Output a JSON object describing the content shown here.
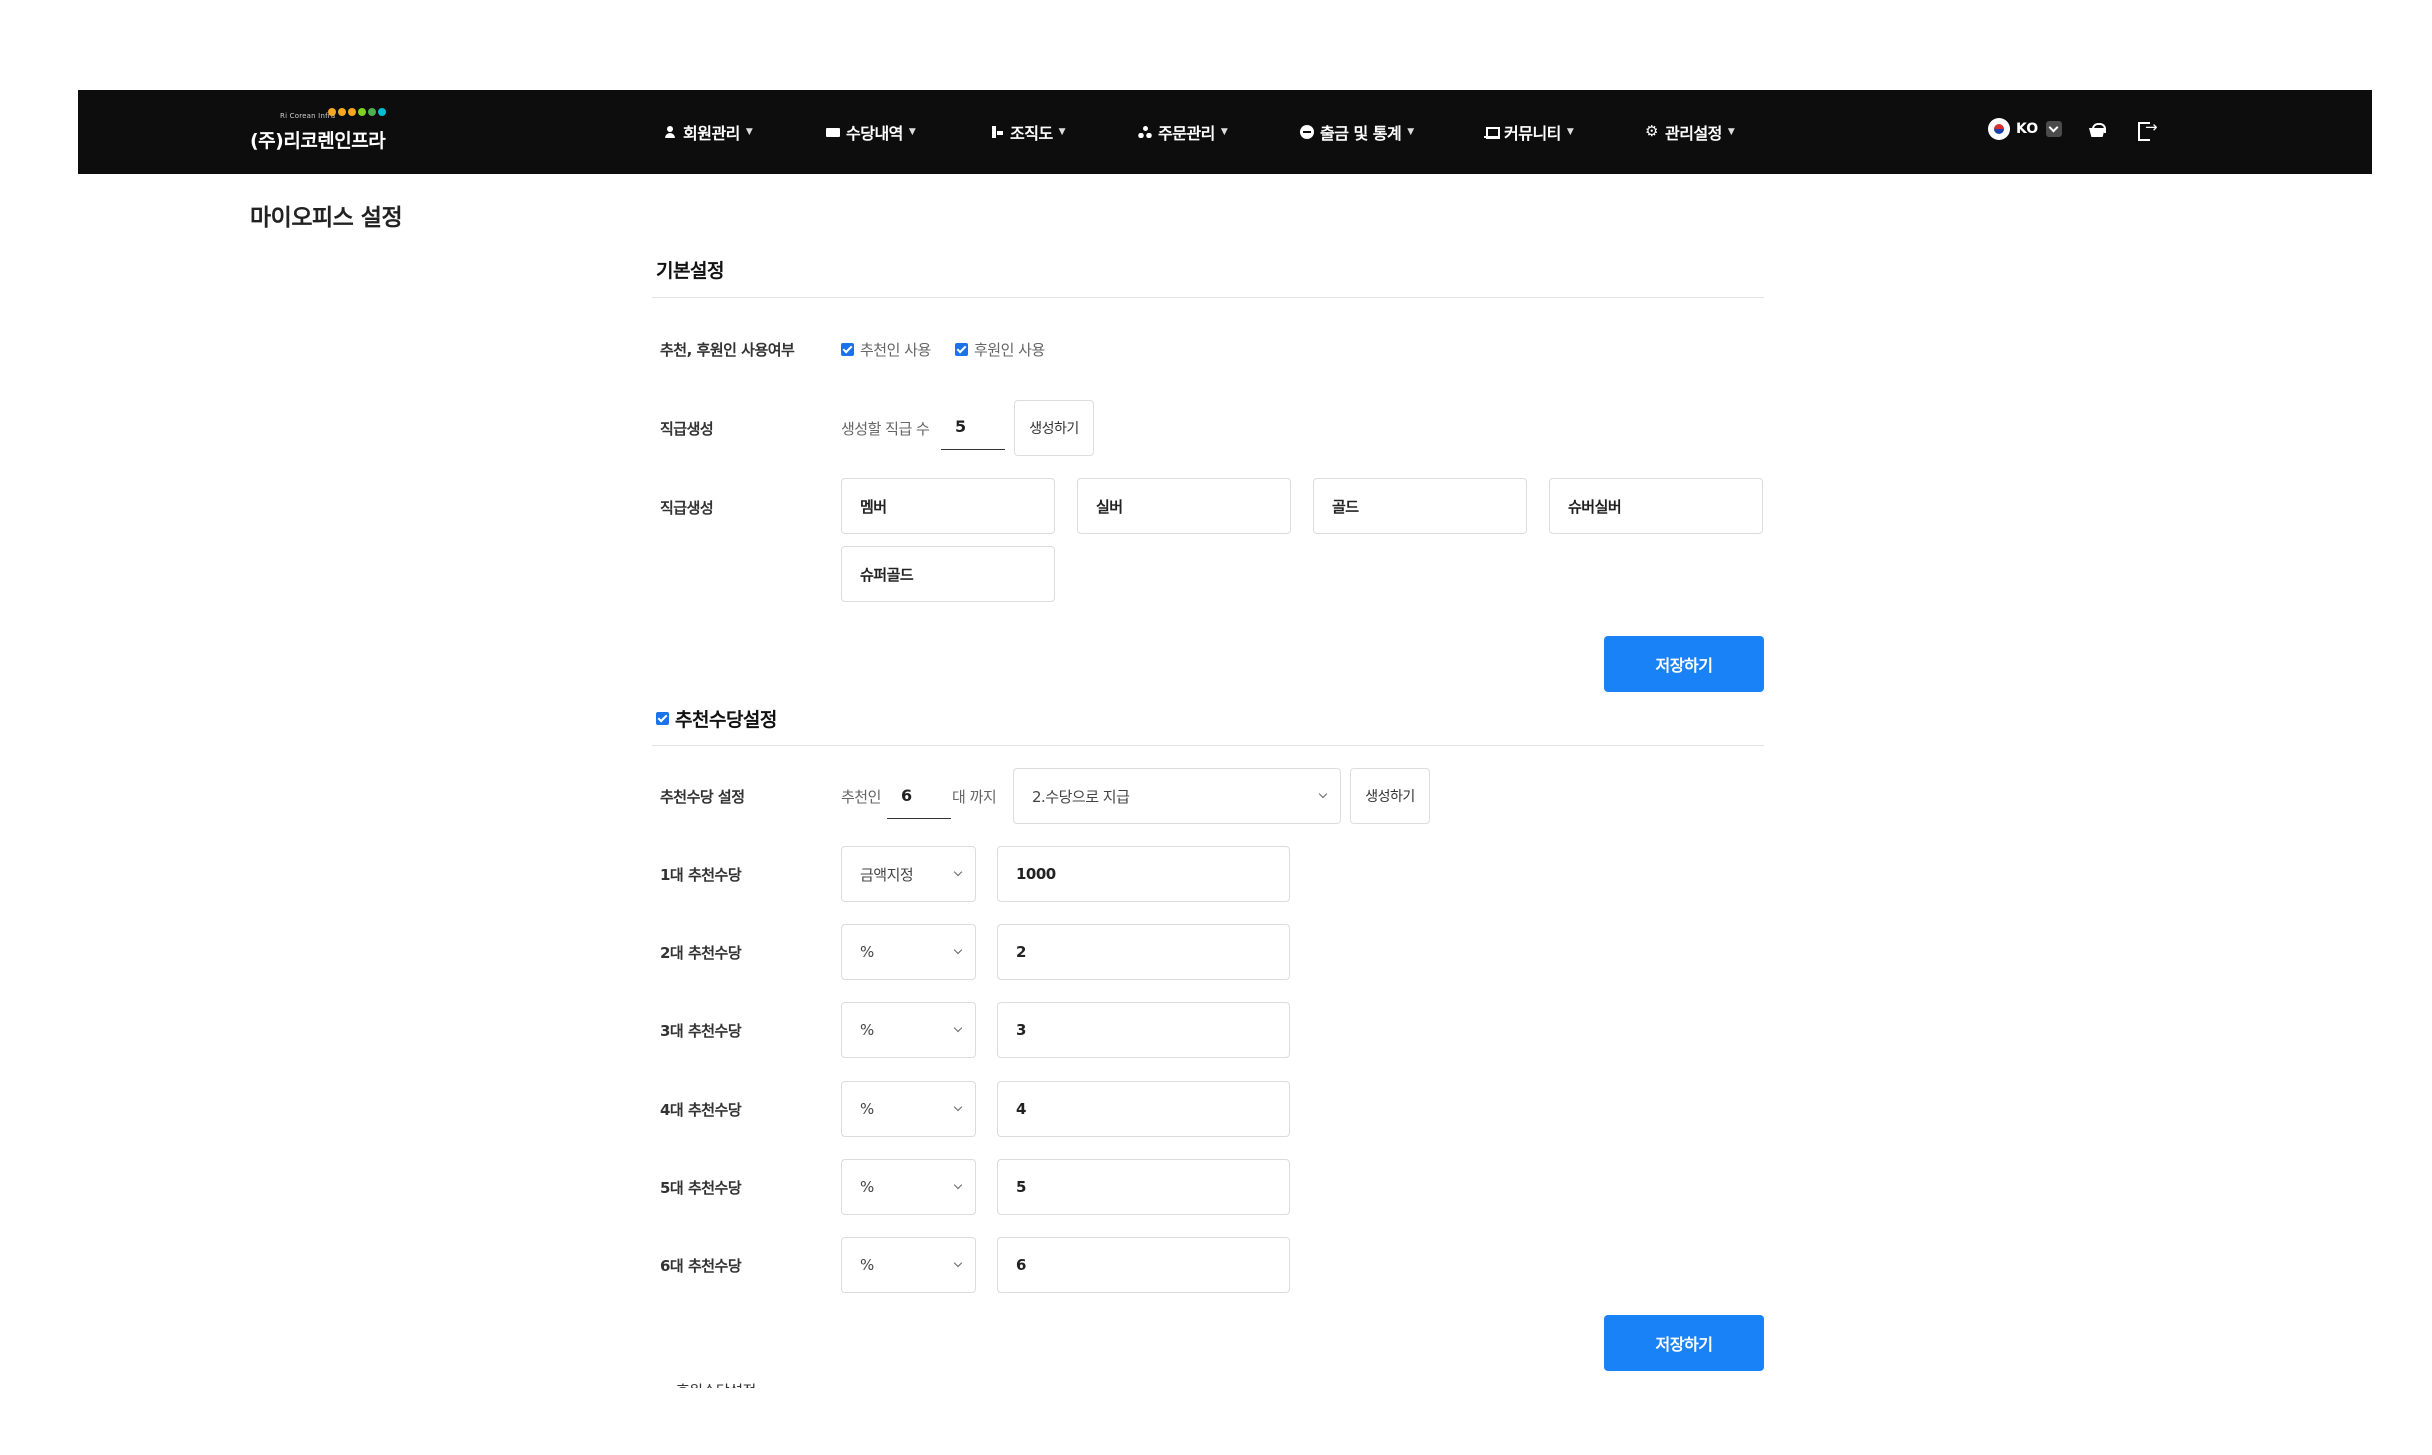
{
  "nav": {
    "logo_sub": "Ri Corean Infra",
    "logo_text": "(주)리코렌인프라",
    "logo_dot_colors": [
      "#f5a623",
      "#f5a623",
      "#f5a623",
      "#7ed321",
      "#4caf50",
      "#00bcd4"
    ],
    "menus": [
      "회원관리",
      "수당내역",
      "조직도",
      "주문관리",
      "출금 및 통계",
      "커뮤니티",
      "관리설정"
    ],
    "lang": "KO"
  },
  "page": {
    "title": "마이오피스 설정"
  },
  "basic": {
    "title": "기본설정",
    "usage_label": "추천, 후원인 사용여부",
    "check_recommender": "추천인 사용",
    "check_sponsor": "후원인 사용",
    "rank_create_label": "직급생성",
    "rank_count_prefix": "생성할 직급 수",
    "rank_count_value": "5",
    "generate_button": "생성하기",
    "rank_list_label": "직급생성",
    "ranks": [
      "멤버",
      "실버",
      "골드",
      "슈버실버",
      "슈퍼골드"
    ],
    "save_button": "저장하기"
  },
  "referral": {
    "title": "추천수당설정",
    "setting_label": "추천수당 설정",
    "prefix": "추천인",
    "depth_value": "6",
    "suffix": "대 까지",
    "pay_option": "2.수당으로 지급",
    "generate_button": "생성하기",
    "levels": [
      {
        "label": "1대 추천수당",
        "type": "금액지정",
        "value": "1000"
      },
      {
        "label": "2대 추천수당",
        "type": "%",
        "value": "2"
      },
      {
        "label": "3대 추천수당",
        "type": "%",
        "value": "3"
      },
      {
        "label": "4대 추천수당",
        "type": "%",
        "value": "4"
      },
      {
        "label": "5대 추천수당",
        "type": "%",
        "value": "5"
      },
      {
        "label": "6대 추천수당",
        "type": "%",
        "value": "6"
      }
    ],
    "save_button": "저장하기"
  },
  "next_section_partial": "후원수당설정"
}
